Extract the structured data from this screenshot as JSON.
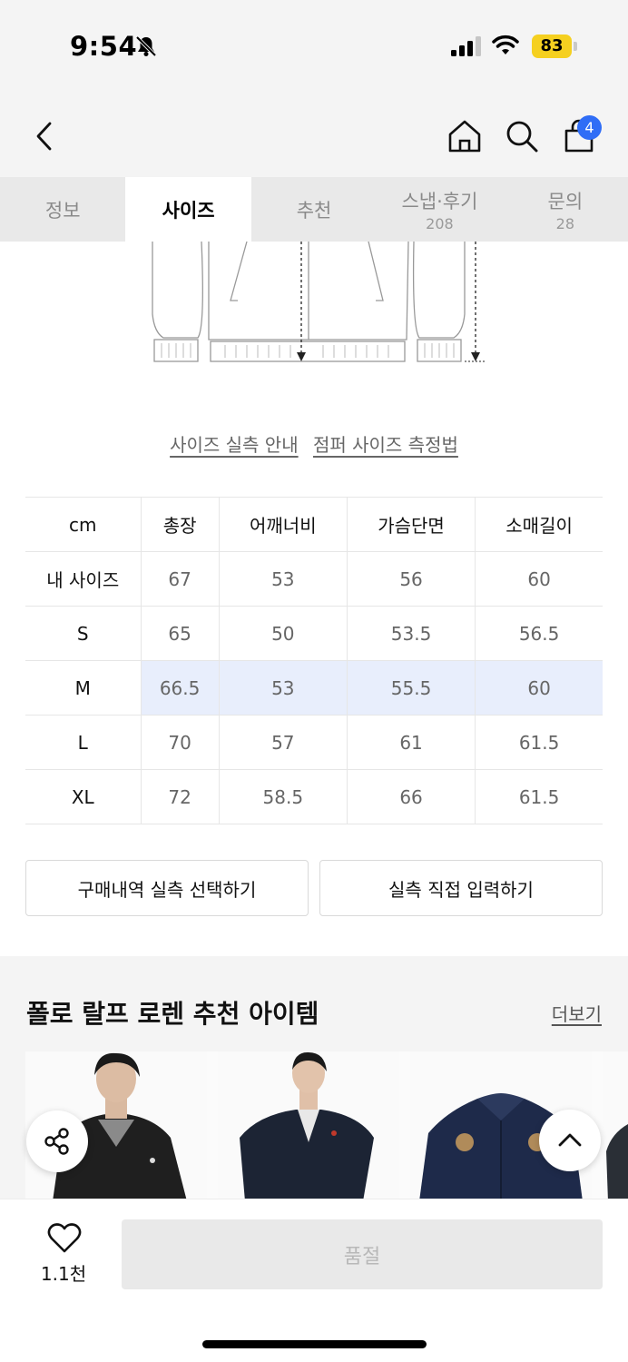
{
  "status_bar": {
    "time": "9:54",
    "battery": "83",
    "icons": [
      "bell-slash-icon",
      "signal-icon",
      "wifi-icon",
      "battery-icon"
    ]
  },
  "nav": {
    "cart_count": "4",
    "icons": [
      "chevron-left-icon",
      "home-icon",
      "search-icon",
      "shopping-bag-icon"
    ]
  },
  "tabs": [
    {
      "label": "정보",
      "count": ""
    },
    {
      "label": "사이즈",
      "count": ""
    },
    {
      "label": "추천",
      "count": ""
    },
    {
      "label": "스냅·후기",
      "count": "208"
    },
    {
      "label": "문의",
      "count": "28"
    }
  ],
  "active_tab": "사이즈",
  "guide_links": {
    "actual_size": "사이즈 실측 안내",
    "how_to_measure": "점퍼 사이즈 측정법"
  },
  "size_table": {
    "headers": [
      "cm",
      "총장",
      "어깨너비",
      "가슴단면",
      "소매길이"
    ],
    "rows": [
      {
        "label": "내 사이즈",
        "values": [
          "67",
          "53",
          "56",
          "60"
        ]
      },
      {
        "label": "S",
        "values": [
          "65",
          "50",
          "53.5",
          "56.5"
        ]
      },
      {
        "label": "M",
        "values": [
          "66.5",
          "53",
          "55.5",
          "60"
        ]
      },
      {
        "label": "L",
        "values": [
          "70",
          "57",
          "61",
          "61.5"
        ]
      },
      {
        "label": "XL",
        "values": [
          "72",
          "58.5",
          "66",
          "61.5"
        ]
      }
    ],
    "highlighted_row": "M"
  },
  "actions": {
    "purchase_history": "구매내역 실측 선택하기",
    "manual_input": "실측 직접 입력하기"
  },
  "recommend": {
    "title": "폴로 랄프 로렌 추천 아이템",
    "more": "더보기"
  },
  "bottom": {
    "like_count": "1.1천",
    "buy_button": "품절"
  },
  "colors": {
    "accent": "#2f6df6",
    "highlight_row": "#e8eefc",
    "battery": "#f5d020"
  }
}
